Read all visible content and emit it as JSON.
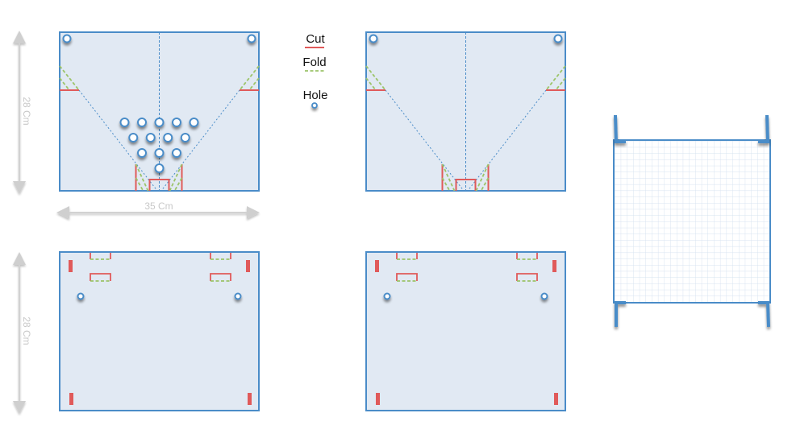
{
  "diagram": {
    "dimensions": {
      "height_label": "28 Cm",
      "width_label": "35 Cm"
    },
    "legend": {
      "items": [
        {
          "label": "Cut",
          "style": "solid",
          "color": "#e05a5a"
        },
        {
          "label": "Fold",
          "style": "dashed",
          "color": "#9cc46a"
        },
        {
          "label": "Hole",
          "style": "circle",
          "color": "#4a8cc8"
        }
      ]
    },
    "colors": {
      "panel_fill": "#e1e9f3",
      "panel_border": "#4a8cc8",
      "cut": "#e05a5a",
      "fold": "#9cc46a",
      "guide": "#4a8cc8",
      "dimension": "#cccccc",
      "grid_line": "#dce6f2"
    },
    "panels": [
      {
        "name": "top-left-panel",
        "peg_rows": [
          5,
          4,
          3,
          1
        ]
      },
      {
        "name": "top-right-panel"
      },
      {
        "name": "bottom-left-panel"
      },
      {
        "name": "bottom-right-panel"
      },
      {
        "name": "grid-net-panel"
      }
    ]
  }
}
